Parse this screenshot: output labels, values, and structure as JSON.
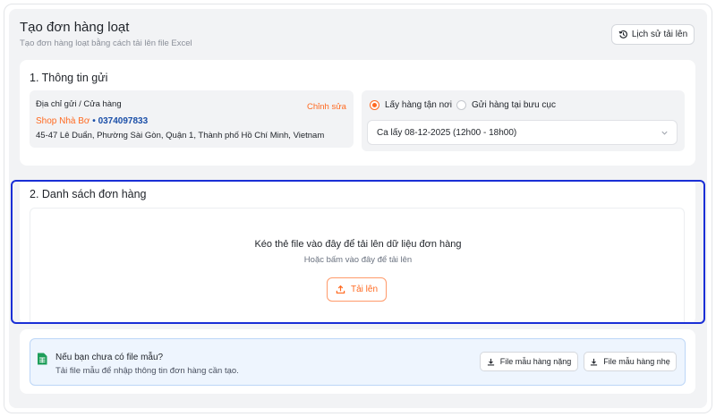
{
  "header": {
    "title": "Tạo đơn hàng loạt",
    "subtitle": "Tạo đơn hàng loạt bằng cách tải lên file Excel",
    "history_button": "Lịch sử tải lên"
  },
  "sender_section": {
    "title": "1. Thông tin gửi",
    "address_label": "Địa chỉ gửi / Cửa hàng",
    "edit_link": "Chỉnh sửa",
    "shop_name": "Shop Nhà Bơ",
    "separator": "•",
    "phone": "0374097833",
    "address": "45-47 Lê Duẩn, Phường Sài Gòn, Quận 1, Thành phố Hồ Chí Minh, Vietnam",
    "pickup_options": [
      {
        "label": "Lấy hàng tận nơi",
        "selected": true
      },
      {
        "label": "Gửi hàng tại bưu cục",
        "selected": false
      }
    ],
    "pickup_time": "Ca lấy 08-12-2025 (12h00 - 18h00)"
  },
  "orders_section": {
    "title": "2. Danh sách đơn hàng",
    "drop_text": "Kéo thẻ file vào đây để tải lên dữ liệu đơn hàng",
    "drop_subtext": "Hoặc bấm vào đây để tải lên",
    "upload_button": "Tải lên"
  },
  "template_banner": {
    "title": "Nếu bạn chưa có file mẫu?",
    "description": "Tải file mẫu để nhập thông tin đơn hàng cần tạo.",
    "heavy_button": "File mẫu hàng nặng",
    "light_button": "File mẫu hàng nhẹ"
  },
  "colors": {
    "accent": "#ff6a21",
    "phone": "#1b4fa8",
    "focus": "#1a2fd6",
    "sheet_icon": "#1e9e5a"
  }
}
